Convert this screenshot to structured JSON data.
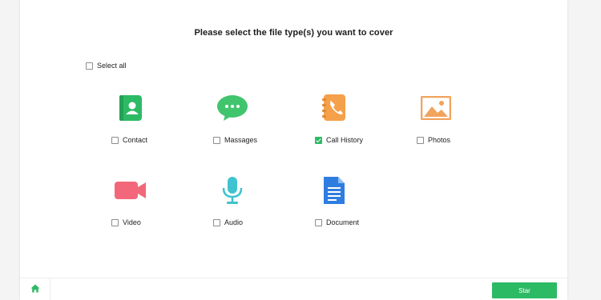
{
  "heading": "Please select the file type(s) you want to cover",
  "select_all": {
    "label": "Select all",
    "checked": false
  },
  "file_types": [
    {
      "label": "Contact",
      "checked": false,
      "icon": "contact-icon",
      "color": "#2dba65"
    },
    {
      "label": "Massages",
      "checked": false,
      "icon": "message-icon",
      "color": "#41c46e"
    },
    {
      "label": "Call History",
      "checked": true,
      "icon": "call-history-icon",
      "color": "#f5a04a"
    },
    {
      "label": "Photos",
      "checked": false,
      "icon": "photo-icon",
      "color": "#f2a35c"
    },
    {
      "label": "Video",
      "checked": false,
      "icon": "video-icon",
      "color": "#f2687a"
    },
    {
      "label": "Audio",
      "checked": false,
      "icon": "microphone-icon",
      "color": "#3ec3cf"
    },
    {
      "label": "Document",
      "checked": false,
      "icon": "document-icon",
      "color": "#2f7de1"
    }
  ],
  "footer": {
    "home_icon": "home-icon",
    "start_label": "Star"
  },
  "colors": {
    "accent": "#2dba65"
  }
}
